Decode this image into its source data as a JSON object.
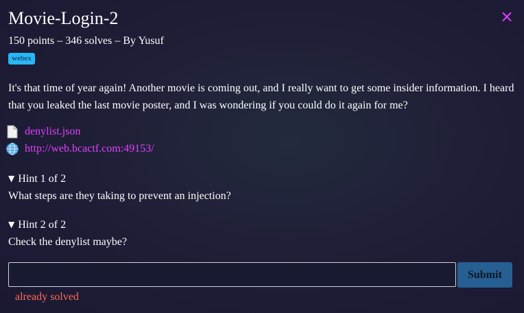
{
  "challenge": {
    "title": "Movie-Login-2",
    "meta": "150 points – 346 solves – By Yusuf",
    "tag": "webex",
    "description": "It's that time of year again! Another movie is coming out, and I really want to get some insider information. I heard that you leaked the last movie poster, and I was wondering if you could do it again for me?"
  },
  "close_symbol": "×",
  "files": [
    {
      "icon": "file-icon",
      "label": "denylist.json"
    },
    {
      "icon": "globe-icon",
      "label": "http://web.bcactf.com:49153/"
    }
  ],
  "hints": [
    {
      "summary": "Hint 1 of 2",
      "text": "What steps are they taking to prevent an injection?"
    },
    {
      "summary": "Hint 2 of 2",
      "text": "Check the denylist maybe?"
    }
  ],
  "flag_form": {
    "input_value": "",
    "submit_label": "Submit",
    "status": "already solved"
  },
  "colors": {
    "accent_link": "#e040fb",
    "tag_bg": "#29b6f6",
    "submit_bg": "#265f92",
    "status_text": "#ff6b57",
    "background": "#1c1a33"
  }
}
